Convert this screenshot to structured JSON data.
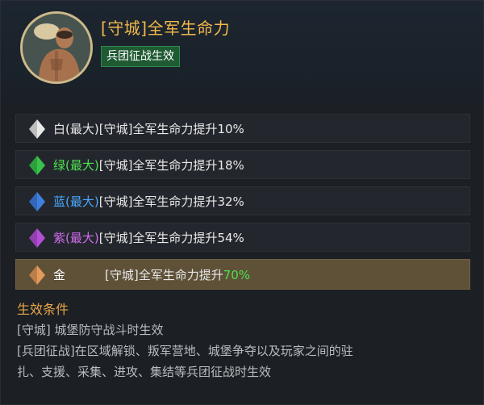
{
  "title": "[守城]全军生命力",
  "tag": "兵团征战生效",
  "rows": [
    {
      "grade": "白(最大)",
      "desc": "[守城]全军生命力提升",
      "pct": "10%",
      "grade_color": "#e6e6e6",
      "gem_color": "#e8e8e8"
    },
    {
      "grade": "绿(最大)",
      "desc": "[守城]全军生命力提升",
      "pct": "18%",
      "grade_color": "#4ee04e",
      "gem_color": "#38c24a"
    },
    {
      "grade": "蓝(最大)",
      "desc": "[守城]全军生命力提升",
      "pct": "32%",
      "grade_color": "#4aa8ff",
      "gem_color": "#3f7fe0"
    },
    {
      "grade": "紫(最大)",
      "desc": "[守城]全军生命力提升",
      "pct": "54%",
      "grade_color": "#d46cf0",
      "gem_color": "#b24fd6"
    },
    {
      "grade": "金",
      "desc": "[守城]全军生命力提升",
      "pct": "70%",
      "grade_color": "#ffffff",
      "gem_color": "#e39a5a"
    }
  ],
  "conditions": {
    "title": "生效条件",
    "line1": "[守城] 城堡防守战斗时生效",
    "line2": "[兵团征战]在区域解锁、叛军营地、城堡争夺以及玩家之间的驻",
    "line3": "扎、支援、采集、进攻、集结等兵团征战时生效"
  },
  "colors": {
    "title": "#f2b94a",
    "tag_bg": "#1f5a33",
    "active_row_bg": "#5e5138",
    "highlight_pct": "#4ee04e",
    "condition_title": "#e8a84a"
  },
  "icons": {
    "avatar": "commander-portrait",
    "gem": "diamond-gem-icon"
  }
}
